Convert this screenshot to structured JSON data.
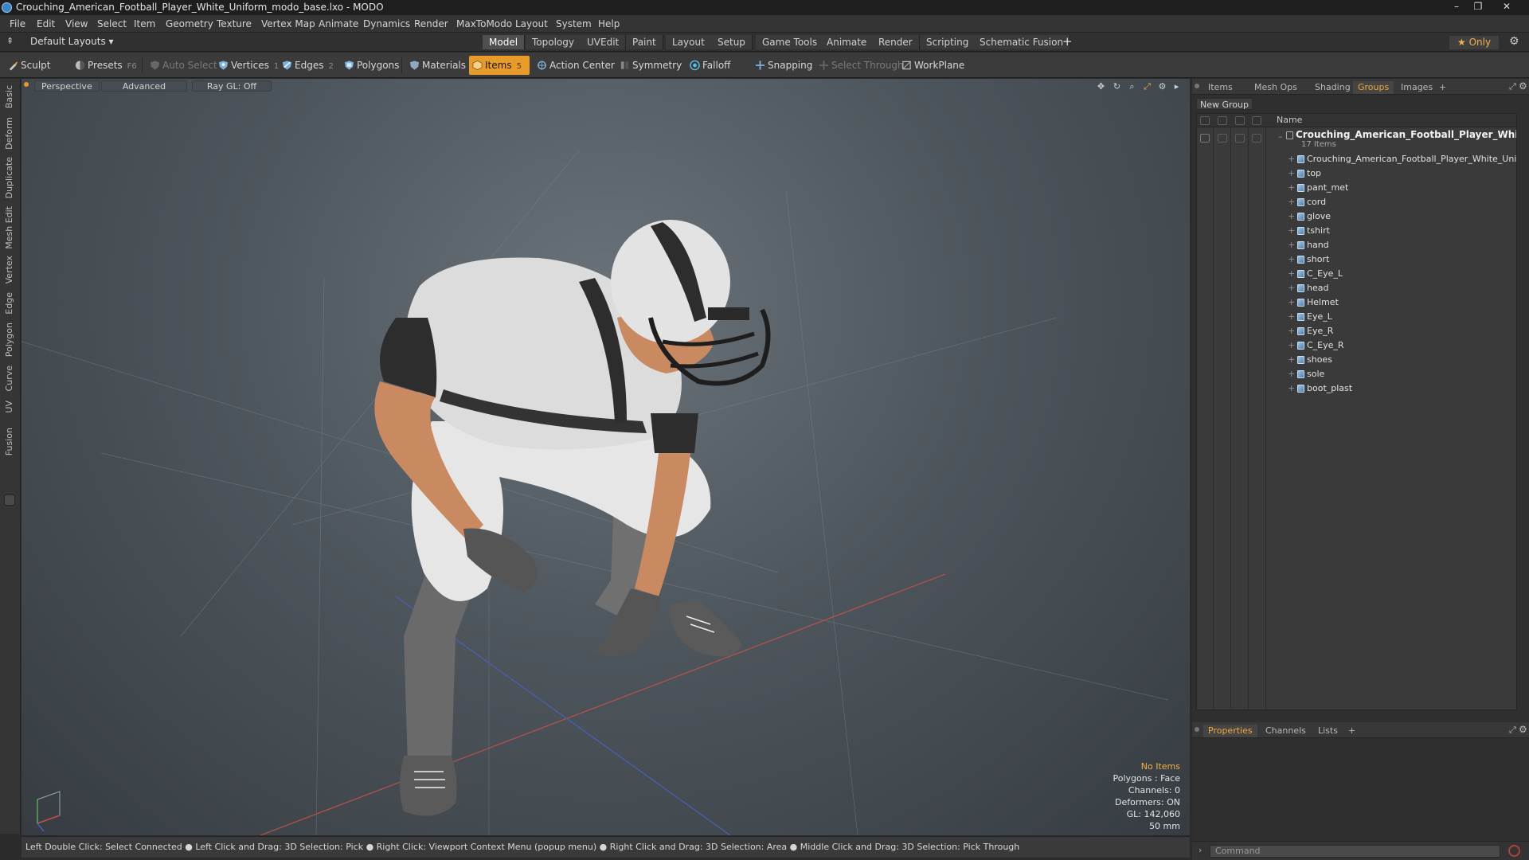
{
  "window": {
    "title": "Crouching_American_Football_Player_White_Uniform_modo_base.lxo - MODO",
    "minimize": "–",
    "maximize": "❐",
    "close": "✕"
  },
  "menu": [
    "File",
    "Edit",
    "View",
    "Select",
    "Item",
    "Geometry",
    "Texture",
    "Vertex Map",
    "Animate",
    "Dynamics",
    "Render",
    "MaxToModo",
    "Layout",
    "System",
    "Help"
  ],
  "layout_bar": {
    "layouts_label": "Default Layouts ▾",
    "tabs": [
      "Model",
      "Topology",
      "UVEdit",
      "Paint",
      "Layout",
      "Setup",
      "Game Tools",
      "Animate",
      "Render",
      "Scripting",
      "Schematic Fusion"
    ],
    "active_tab": "Model",
    "add": "+",
    "only_label": "★ Only",
    "gear": "⚙"
  },
  "toolbar": {
    "sculpt": "Sculpt",
    "presets": "Presets",
    "presets_key": "F6",
    "auto_select": "Auto Select",
    "vertices": "Vertices",
    "vertices_count": "1",
    "edges": "Edges",
    "edges_count": "2",
    "polygons": "Polygons",
    "materials": "Materials",
    "items": "Items",
    "items_count": "5",
    "action_center": "Action Center",
    "symmetry": "Symmetry",
    "falloff": "Falloff",
    "snapping": "Snapping",
    "select_through": "Select Through",
    "workplane": "WorkPlane"
  },
  "left_tabs": [
    "Basic",
    "Deform",
    "Duplicate",
    "Mesh Edit",
    "Vertex",
    "Edge",
    "Polygon",
    "Curve",
    "UV",
    "Fusion"
  ],
  "viewport": {
    "view": "Perspective",
    "mode": "Advanced",
    "raygl": "Ray GL: Off",
    "info": {
      "items": "No Items",
      "polygons": "Polygons : Face",
      "channels": "Channels: 0",
      "deformers": "Deformers: ON",
      "gl": "GL: 142,060",
      "lens": "50 mm"
    }
  },
  "status_bar": "Left Double Click: Select Connected ● Left Click and Drag: 3D Selection: Pick ● Right Click: Viewport Context Menu (popup menu) ● Right Click and Drag: 3D Selection: Area ● Middle Click and Drag: 3D Selection: Pick Through",
  "right_panel": {
    "tabs": [
      "Items",
      "Mesh Ops",
      "Shading",
      "Groups",
      "Images"
    ],
    "active_tab": "Groups",
    "add": "+",
    "new_group": "New Group",
    "name_header": "Name",
    "root": {
      "title": "Crouching_American_Football_Player_White_...",
      "count": "17 Items"
    },
    "items": [
      "Crouching_American_Football_Player_White_Uniform",
      "top",
      "pant_met",
      "cord",
      "glove",
      "tshirt",
      "hand",
      "short",
      "C_Eye_L",
      "head",
      "Helmet",
      "Eye_L",
      "Eye_R",
      "C_Eye_R",
      "shoes",
      "sole",
      "boot_plast"
    ],
    "bottom_tabs": [
      "Properties",
      "Channels",
      "Lists"
    ],
    "bottom_active": "Properties",
    "command_placeholder": "Command"
  },
  "colors": {
    "accent": "#e89a2a",
    "jersey": "#dcdcdc",
    "stripe": "#2d2d2d",
    "skin": "#c98a62",
    "x_axis": "#c0504a",
    "z_axis": "#4a5fb8"
  }
}
